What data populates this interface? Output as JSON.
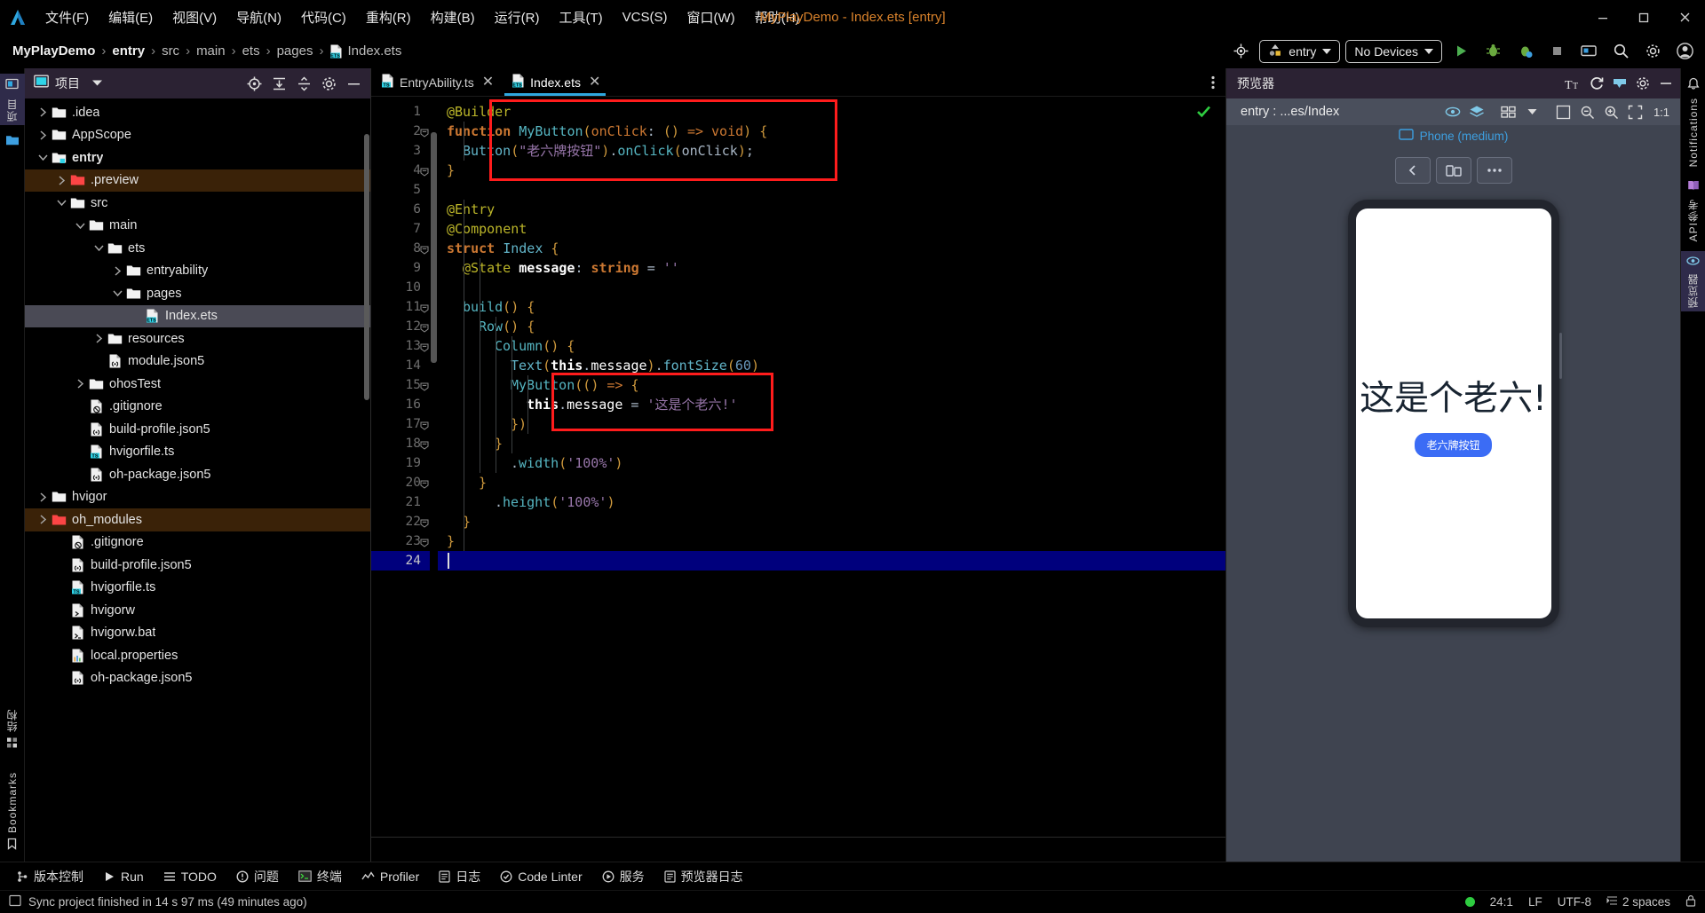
{
  "window": {
    "title": "MyPlayDemo - Index.ets [entry]",
    "logo_icon": "deveco-logo-icon",
    "minimize_icon": "minimize-icon",
    "maximize_icon": "maximize-icon",
    "close_icon": "close-icon"
  },
  "menubar": {
    "items": [
      {
        "label": "文件(F)",
        "name": "menu-file"
      },
      {
        "label": "编辑(E)",
        "name": "menu-edit"
      },
      {
        "label": "视图(V)",
        "name": "menu-view"
      },
      {
        "label": "导航(N)",
        "name": "menu-navigate"
      },
      {
        "label": "代码(C)",
        "name": "menu-code"
      },
      {
        "label": "重构(R)",
        "name": "menu-refactor"
      },
      {
        "label": "构建(B)",
        "name": "menu-build"
      },
      {
        "label": "运行(R)",
        "name": "menu-run"
      },
      {
        "label": "工具(T)",
        "name": "menu-tools"
      },
      {
        "label": "VCS(S)",
        "name": "menu-vcs"
      },
      {
        "label": "窗口(W)",
        "name": "menu-window"
      },
      {
        "label": "帮助(H)",
        "name": "menu-help"
      }
    ]
  },
  "breadcrumb": {
    "items": [
      "MyPlayDemo",
      "entry",
      "src",
      "main",
      "ets",
      "pages",
      "Index.ets"
    ],
    "file_icon": "ets-file-icon"
  },
  "toolbar": {
    "target_icon": "navigate-target-icon",
    "run_config": "entry",
    "run_config_icon": "module-entry-icon",
    "device_select": "No Devices",
    "run_icon": "run-icon",
    "debug_icon": "debug-icon",
    "profile_icon": "profile-icon",
    "stop_icon": "stop-icon",
    "device_manager_icon": "device-manager-icon",
    "search_icon": "search-icon",
    "settings_icon": "gear-icon",
    "account_icon": "account-icon"
  },
  "left_rail": {
    "top_items": [
      {
        "name": "rail-project-icon",
        "label": "项目"
      },
      {
        "name": "rail-resource-icon",
        "label": ""
      }
    ],
    "bottom_items": [
      {
        "name": "rail-structure-label",
        "label": "结构"
      },
      {
        "name": "rail-bookmarks-label",
        "label": "Bookmarks"
      }
    ]
  },
  "project_panel": {
    "title": "项目",
    "title_icon": "project-view-icon",
    "dropdown_icon": "chevron-down-icon",
    "actions": [
      {
        "name": "select-opened-file-icon",
        "label": ""
      },
      {
        "name": "expand-all-icon",
        "label": ""
      },
      {
        "name": "collapse-all-icon",
        "label": ""
      },
      {
        "name": "panel-settings-gear-icon",
        "label": ""
      },
      {
        "name": "panel-hide-icon",
        "label": ""
      }
    ],
    "tree": [
      {
        "label": ".idea",
        "depth": 1,
        "arrow": "right",
        "icon": "folder",
        "state": ""
      },
      {
        "label": "AppScope",
        "depth": 1,
        "arrow": "right",
        "icon": "folder",
        "state": ""
      },
      {
        "label": "entry",
        "depth": 1,
        "arrow": "down",
        "icon": "folder-module",
        "state": "bold"
      },
      {
        "label": ".preview",
        "depth": 2,
        "arrow": "right",
        "icon": "folder-red",
        "state": "vcs"
      },
      {
        "label": "src",
        "depth": 2,
        "arrow": "down",
        "icon": "folder",
        "state": ""
      },
      {
        "label": "main",
        "depth": 3,
        "arrow": "down",
        "icon": "folder",
        "state": ""
      },
      {
        "label": "ets",
        "depth": 4,
        "arrow": "down",
        "icon": "folder",
        "state": ""
      },
      {
        "label": "entryability",
        "depth": 5,
        "arrow": "right",
        "icon": "folder",
        "state": ""
      },
      {
        "label": "pages",
        "depth": 5,
        "arrow": "down",
        "icon": "folder",
        "state": ""
      },
      {
        "label": "Index.ets",
        "depth": 6,
        "arrow": "none",
        "icon": "ets",
        "state": "sel"
      },
      {
        "label": "resources",
        "depth": 4,
        "arrow": "right",
        "icon": "folder",
        "state": ""
      },
      {
        "label": "module.json5",
        "depth": 4,
        "arrow": "none",
        "icon": "json5",
        "state": ""
      },
      {
        "label": "ohosTest",
        "depth": 3,
        "arrow": "right",
        "icon": "folder",
        "state": ""
      },
      {
        "label": ".gitignore",
        "depth": 3,
        "arrow": "none",
        "icon": "gitignore",
        "state": ""
      },
      {
        "label": "build-profile.json5",
        "depth": 3,
        "arrow": "none",
        "icon": "json5",
        "state": ""
      },
      {
        "label": "hvigorfile.ts",
        "depth": 3,
        "arrow": "none",
        "icon": "ts",
        "state": ""
      },
      {
        "label": "oh-package.json5",
        "depth": 3,
        "arrow": "none",
        "icon": "json5",
        "state": ""
      },
      {
        "label": "hvigor",
        "depth": 1,
        "arrow": "right",
        "icon": "folder",
        "state": ""
      },
      {
        "label": "oh_modules",
        "depth": 1,
        "arrow": "right",
        "icon": "folder-red",
        "state": "vcs"
      },
      {
        "label": ".gitignore",
        "depth": 2,
        "arrow": "none",
        "icon": "gitignore",
        "state": ""
      },
      {
        "label": "build-profile.json5",
        "depth": 2,
        "arrow": "none",
        "icon": "json5",
        "state": ""
      },
      {
        "label": "hvigorfile.ts",
        "depth": 2,
        "arrow": "none",
        "icon": "ts",
        "state": ""
      },
      {
        "label": "hvigorw",
        "depth": 2,
        "arrow": "none",
        "icon": "script",
        "state": ""
      },
      {
        "label": "hvigorw.bat",
        "depth": 2,
        "arrow": "none",
        "icon": "bat",
        "state": ""
      },
      {
        "label": "local.properties",
        "depth": 2,
        "arrow": "none",
        "icon": "properties",
        "state": ""
      },
      {
        "label": "oh-package.json5",
        "depth": 2,
        "arrow": "none",
        "icon": "json5",
        "state": ""
      }
    ]
  },
  "editor": {
    "tabs": [
      {
        "label": "EntryAbility.ts",
        "icon": "ts-file-icon",
        "active": false
      },
      {
        "label": "Index.ets",
        "icon": "ets-file-icon",
        "active": true
      }
    ],
    "more_icon": "more-vertical-icon",
    "inspection_ok_icon": "check-ok-icon",
    "current_line": 24,
    "lines": [
      {
        "n": 1,
        "tokens": [
          {
            "t": "@Builder",
            "c": "t-dec"
          }
        ],
        "indent": 1
      },
      {
        "n": 2,
        "tokens": [
          {
            "t": "function",
            "c": "t-kw"
          },
          {
            "t": " ",
            "c": ""
          },
          {
            "t": "MyButton",
            "c": "t-fn"
          },
          {
            "t": "(",
            "c": "t-pun"
          },
          {
            "t": "onClick",
            "c": "t-par"
          },
          {
            "t": ": ",
            "c": "t-id"
          },
          {
            "t": "(",
            "c": "t-pun"
          },
          {
            "t": ")",
            "c": "t-pun"
          },
          {
            "t": " ",
            "c": ""
          },
          {
            "t": "=>",
            "c": "t-arrow"
          },
          {
            "t": " ",
            "c": ""
          },
          {
            "t": "void",
            "c": "t-par"
          },
          {
            "t": ")",
            "c": "t-pun"
          },
          {
            "t": " ",
            "c": ""
          },
          {
            "t": "{",
            "c": "t-pun"
          }
        ],
        "indent": 1
      },
      {
        "n": 3,
        "tokens": [
          {
            "t": "Button",
            "c": "t-type"
          },
          {
            "t": "(",
            "c": "t-pun"
          },
          {
            "t": "\"老六牌按钮\"",
            "c": "t-str"
          },
          {
            "t": ")",
            "c": "t-pun"
          },
          {
            "t": ".",
            "c": "t-id"
          },
          {
            "t": "onClick",
            "c": "t-fn"
          },
          {
            "t": "(",
            "c": "t-pun"
          },
          {
            "t": "onClick",
            "c": "t-id"
          },
          {
            "t": ")",
            "c": "t-pun"
          },
          {
            "t": ";",
            "c": "t-id"
          }
        ],
        "indent": 2
      },
      {
        "n": 4,
        "tokens": [
          {
            "t": "}",
            "c": "t-pun"
          }
        ],
        "indent": 1
      },
      {
        "n": 5,
        "tokens": [],
        "indent": 1
      },
      {
        "n": 6,
        "tokens": [
          {
            "t": "@Entry",
            "c": "t-dec"
          }
        ],
        "indent": 1
      },
      {
        "n": 7,
        "tokens": [
          {
            "t": "@Component",
            "c": "t-dec"
          }
        ],
        "indent": 1
      },
      {
        "n": 8,
        "tokens": [
          {
            "t": "struct",
            "c": "t-kw"
          },
          {
            "t": " ",
            "c": ""
          },
          {
            "t": "Index",
            "c": "t-type"
          },
          {
            "t": " ",
            "c": ""
          },
          {
            "t": "{",
            "c": "t-pun"
          }
        ],
        "indent": 1
      },
      {
        "n": 9,
        "tokens": [
          {
            "t": "@State",
            "c": "t-dec"
          },
          {
            "t": " ",
            "c": ""
          },
          {
            "t": "message",
            "c": "t-this"
          },
          {
            "t": ": ",
            "c": "t-id"
          },
          {
            "t": "string",
            "c": "t-kw"
          },
          {
            "t": " = ",
            "c": "t-id"
          },
          {
            "t": "''",
            "c": "t-str"
          }
        ],
        "indent": 2
      },
      {
        "n": 10,
        "tokens": [],
        "indent": 2
      },
      {
        "n": 11,
        "tokens": [
          {
            "t": "build",
            "c": "t-fn"
          },
          {
            "t": "(",
            "c": "t-pun"
          },
          {
            "t": ")",
            "c": "t-pun"
          },
          {
            "t": " ",
            "c": ""
          },
          {
            "t": "{",
            "c": "t-pun"
          }
        ],
        "indent": 2
      },
      {
        "n": 12,
        "tokens": [
          {
            "t": "Row",
            "c": "t-fn"
          },
          {
            "t": "(",
            "c": "t-pun"
          },
          {
            "t": ")",
            "c": "t-pun"
          },
          {
            "t": " ",
            "c": ""
          },
          {
            "t": "{",
            "c": "t-pun"
          }
        ],
        "indent": 3
      },
      {
        "n": 13,
        "tokens": [
          {
            "t": "Column",
            "c": "t-fn"
          },
          {
            "t": "(",
            "c": "t-pun"
          },
          {
            "t": ")",
            "c": "t-pun"
          },
          {
            "t": " ",
            "c": ""
          },
          {
            "t": "{",
            "c": "t-pun"
          }
        ],
        "indent": 4
      },
      {
        "n": 14,
        "tokens": [
          {
            "t": "Text",
            "c": "t-type"
          },
          {
            "t": "(",
            "c": "t-pun"
          },
          {
            "t": "this",
            "c": "t-this"
          },
          {
            "t": ".",
            "c": "t-id"
          },
          {
            "t": "message",
            "c": "t-prop"
          },
          {
            "t": ")",
            "c": "t-pun"
          },
          {
            "t": ".",
            "c": "t-id"
          },
          {
            "t": "fontSize",
            "c": "t-type"
          },
          {
            "t": "(",
            "c": "t-pun"
          },
          {
            "t": "60",
            "c": "t-num"
          },
          {
            "t": ")",
            "c": "t-pun"
          }
        ],
        "indent": 5
      },
      {
        "n": 15,
        "tokens": [
          {
            "t": "MyButton",
            "c": "t-fn"
          },
          {
            "t": "(",
            "c": "t-pun"
          },
          {
            "t": "(",
            "c": "t-pun"
          },
          {
            "t": ")",
            "c": "t-pun"
          },
          {
            "t": " ",
            "c": ""
          },
          {
            "t": "=>",
            "c": "t-arrow"
          },
          {
            "t": " ",
            "c": ""
          },
          {
            "t": "{",
            "c": "t-pun"
          }
        ],
        "indent": 5
      },
      {
        "n": 16,
        "tokens": [
          {
            "t": "this",
            "c": "t-this"
          },
          {
            "t": ".",
            "c": "t-id"
          },
          {
            "t": "message",
            "c": "t-prop"
          },
          {
            "t": " = ",
            "c": "t-id"
          },
          {
            "t": "'这是个老六!'",
            "c": "t-str"
          }
        ],
        "indent": 6
      },
      {
        "n": 17,
        "tokens": [
          {
            "t": "}",
            "c": "t-pun"
          },
          {
            "t": ")",
            "c": "t-pun"
          }
        ],
        "indent": 5
      },
      {
        "n": 18,
        "tokens": [
          {
            "t": "}",
            "c": "t-pun"
          }
        ],
        "indent": 4
      },
      {
        "n": 19,
        "tokens": [
          {
            "t": ".",
            "c": "t-id"
          },
          {
            "t": "width",
            "c": "t-fn"
          },
          {
            "t": "(",
            "c": "t-pun"
          },
          {
            "t": "'100%'",
            "c": "t-str"
          },
          {
            "t": ")",
            "c": "t-pun"
          }
        ],
        "indent": 5
      },
      {
        "n": 20,
        "tokens": [
          {
            "t": "}",
            "c": "t-pun"
          }
        ],
        "indent": 3
      },
      {
        "n": 21,
        "tokens": [
          {
            "t": ".",
            "c": "t-id"
          },
          {
            "t": "height",
            "c": "t-fn"
          },
          {
            "t": "(",
            "c": "t-pun"
          },
          {
            "t": "'100%'",
            "c": "t-str"
          },
          {
            "t": ")",
            "c": "t-pun"
          }
        ],
        "indent": 4
      },
      {
        "n": 22,
        "tokens": [
          {
            "t": "}",
            "c": "t-pun"
          }
        ],
        "indent": 2
      },
      {
        "n": 23,
        "tokens": [
          {
            "t": "}",
            "c": "t-pun"
          }
        ],
        "indent": 1
      },
      {
        "n": 24,
        "tokens": [],
        "indent": 1
      }
    ]
  },
  "preview": {
    "title": "预览器",
    "actions": [
      {
        "name": "font-size-icon",
        "label": ""
      },
      {
        "name": "refresh-icon",
        "label": ""
      },
      {
        "name": "inspector-icon",
        "label": ""
      },
      {
        "name": "preview-settings-gear-icon",
        "label": ""
      },
      {
        "name": "preview-hide-icon",
        "label": ""
      }
    ],
    "path": "entry : ...es/Index",
    "sub_actions": [
      {
        "name": "eye-icon",
        "label": ""
      },
      {
        "name": "layers-icon",
        "label": ""
      },
      {
        "name": "grid-icon",
        "label": ""
      },
      {
        "name": "grid-dropdown-icon",
        "label": ""
      },
      {
        "name": "fit-icon",
        "label": ""
      },
      {
        "name": "zoom-out-icon",
        "label": ""
      },
      {
        "name": "zoom-in-icon",
        "label": ""
      },
      {
        "name": "fullscreen-icon",
        "label": ""
      },
      {
        "name": "scale-1-1-icon",
        "label": "1:1"
      }
    ],
    "device_label": "Phone (medium)",
    "device_icon": "phone-device-icon",
    "ctrl_buttons": [
      {
        "name": "rotate-left-icon",
        "label": ""
      },
      {
        "name": "multi-device-icon",
        "label": ""
      },
      {
        "name": "more-options-icon",
        "label": ""
      }
    ],
    "screen": {
      "message": "这是个老六!",
      "button_label": "老六牌按钮",
      "button_color": "#3b6cf5"
    }
  },
  "right_rail": {
    "items": [
      {
        "name": "rail-notifications-label",
        "label": "Notifications"
      },
      {
        "name": "rail-api-label",
        "label": "API参考"
      },
      {
        "name": "rail-previewer-label",
        "label": "预览器",
        "active": true
      }
    ]
  },
  "bottom_toolbar": {
    "items": [
      {
        "label": "版本控制",
        "icon": "vcs-branch-icon",
        "name": "tool-version-control"
      },
      {
        "label": "Run",
        "icon": "run-play-icon",
        "name": "tool-run"
      },
      {
        "label": "TODO",
        "icon": "todo-list-icon",
        "name": "tool-todo"
      },
      {
        "label": "问题",
        "icon": "problems-icon",
        "name": "tool-problems"
      },
      {
        "label": "终端",
        "icon": "terminal-icon",
        "name": "tool-terminal"
      },
      {
        "label": "Profiler",
        "icon": "profiler-icon",
        "name": "tool-profiler"
      },
      {
        "label": "日志",
        "icon": "log-icon",
        "name": "tool-log"
      },
      {
        "label": "Code Linter",
        "icon": "code-linter-icon",
        "name": "tool-code-linter"
      },
      {
        "label": "服务",
        "icon": "services-icon",
        "name": "tool-services"
      },
      {
        "label": "预览器日志",
        "icon": "preview-log-icon",
        "name": "tool-preview-log"
      }
    ]
  },
  "statusbar": {
    "message": "Sync project finished in 14 s 97 ms (49 minutes ago)",
    "message_icon": "event-log-icon",
    "caret_position": "24:1",
    "line_separator": "LF",
    "encoding": "UTF-8",
    "indent": "2 spaces",
    "indent_icon": "indent-icon",
    "lock_icon": "lock-icon",
    "status_dot_color": "#2ecc40"
  }
}
